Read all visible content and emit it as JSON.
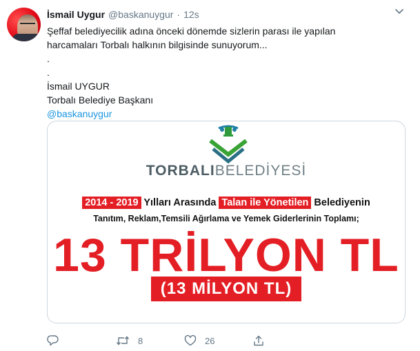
{
  "tweet": {
    "display_name": "İsmail Uygur",
    "handle": "@baskanuygur",
    "separator": "·",
    "time": "12s",
    "lines": [
      "Şeffaf belediyecilik adına önceki dönemde sizlerin parası ile yapılan",
      "harcamaları Torbalı halkının bilgisinde sunuyorum...",
      ".",
      ".",
      "İsmail UYGUR",
      "Torbalı Belediye Başkanı"
    ],
    "mention": "@baskanuygur"
  },
  "card": {
    "logo_text_bold": "TORBALI",
    "logo_text_light": "BELEDİYESİ",
    "range_label": "2014 - 2019",
    "text_mid": " Yılları Arasında ",
    "highlight": "Talan ile Yönetilen",
    "text_end": " Belediyenin",
    "line2": "Tanıtım, Reklam,Temsili Ağırlama ve Yemek Giderlerinin Toplamı;",
    "big_amount": "13 TRİLYON TL",
    "sub_amount": "(13 MİLYON TL)",
    "accent_color": "#e31e24",
    "logo_green": "#3aa335"
  },
  "actions": {
    "reply_icon": "reply-icon",
    "retweet_icon": "retweet-icon",
    "retweet_count": "8",
    "like_icon": "like-icon",
    "like_count": "26",
    "share_icon": "share-icon"
  }
}
